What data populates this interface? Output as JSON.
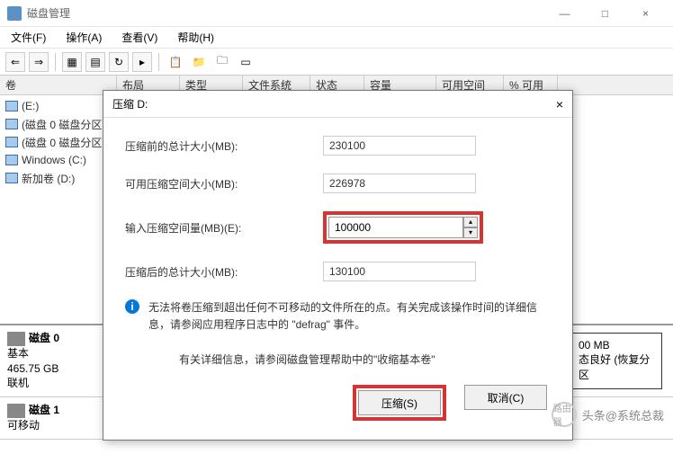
{
  "window": {
    "title": "磁盘管理",
    "minimize": "—",
    "maximize": "□",
    "close": "×"
  },
  "menu": {
    "file": "文件(F)",
    "action": "操作(A)",
    "view": "查看(V)",
    "help": "帮助(H)"
  },
  "columns": {
    "volume": "卷",
    "layout": "布局",
    "type": "类型",
    "filesystem": "文件系统",
    "status": "状态",
    "capacity": "容量",
    "free": "可用空间",
    "pctfree": "% 可用"
  },
  "volumes": [
    {
      "name": "(E:)"
    },
    {
      "name": "(磁盘 0 磁盘分区"
    },
    {
      "name": "(磁盘 0 磁盘分区"
    },
    {
      "name": "Windows (C:)"
    },
    {
      "name": "新加卷 (D:)"
    }
  ],
  "disk0": {
    "name": "磁盘 0",
    "type": "基本",
    "size": "465.75 GB",
    "status": "联机",
    "part_size": "00 MB",
    "part_status": "态良好 (恢复分区"
  },
  "disk1": {
    "name": "磁盘 1",
    "type": "可移动"
  },
  "dialog": {
    "title": "压缩 D:",
    "close": "×",
    "label_total_before": "压缩前的总计大小(MB):",
    "val_total_before": "230100",
    "label_avail": "可用压缩空间大小(MB):",
    "val_avail": "226978",
    "label_input": "输入压缩空间量(MB)(E):",
    "val_input": "100000",
    "label_total_after": "压缩后的总计大小(MB):",
    "val_total_after": "130100",
    "info_icon": "i",
    "info_text": "无法将卷压缩到超出任何不可移动的文件所在的点。有关完成该操作时间的详细信息，请参阅应用程序日志中的 \"defrag\" 事件。",
    "help_text": "有关详细信息，请参阅磁盘管理帮助中的\"收缩基本卷\"",
    "btn_shrink": "压缩(S)",
    "btn_cancel": "取消(C)"
  },
  "watermark": {
    "logo": "路由器",
    "text": "头条@系统总裁"
  }
}
